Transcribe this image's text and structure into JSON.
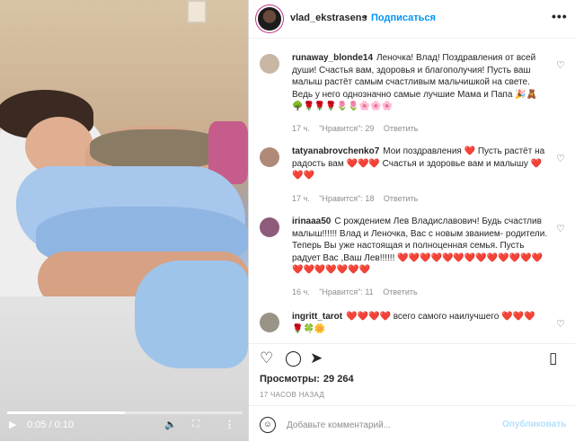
{
  "video": {
    "time_label": "0:05 / 0:10",
    "progress": 0.5
  },
  "post": {
    "author": "vlad_ekstrasens",
    "dot": "•",
    "follow_label": "Подписаться",
    "more_label": "•••"
  },
  "comments": [
    {
      "user": "runaway_blonde14",
      "text": "Леночка! Влад! Поздравления от всей души! Счастья вам, здоровья и благополучия! Пусть ваш малыш растёт самым счастливым мальчишкой на свете. Ведь у него однозначно самые лучшие Мама и Папа 🎉🧸",
      "extra": "🌳🌹🌹🌹🌷🌷🌸🌸🌸",
      "time": "17 ч.",
      "likes": "\"Нравится\": 29",
      "reply": "Ответить",
      "avatar_color": "#c9b7a6"
    },
    {
      "user": "tatyanabrovchenko7",
      "text": "Мои поздравления ❤️ Пусть растёт на радость вам ❤️❤️❤️ Счастья и здоровье вам и малышу ❤️",
      "extra": "❤️❤️",
      "time": "17 ч.",
      "likes": "\"Нравится\": 18",
      "reply": "Ответить",
      "avatar_color": "#b08a78"
    },
    {
      "user": "irinaaa50",
      "text": "С рождением Лев Владиславович! Будь счастлив малыш!!!!!! Влад и Леночка, Вас с новым званием- родители. Теперь Вы уже настоящая и полноценная семья. Пусть радует Вас ,Ваш Лев!!!!!! ❤️❤️❤️❤️❤️❤️❤️❤️❤️❤️❤️❤️❤️❤️❤️❤️❤️❤️❤️❤️",
      "extra": "",
      "time": "16 ч.",
      "likes": "\"Нравится\": 11",
      "reply": "Ответить",
      "avatar_color": "#8e5b7a"
    },
    {
      "user": "ingritt_tarot",
      "text": "❤️❤️❤️❤️ всего самого наилучшего ❤️❤️❤️",
      "extra": "🌹🍀🌼",
      "time": "",
      "likes": "",
      "reply": "",
      "avatar_color": "#9a9488"
    }
  ],
  "stats": {
    "views_label": "Просмотры:",
    "views_value": "29 264",
    "ago": "17 ЧАСОВ НАЗАД"
  },
  "composer": {
    "placeholder": "Добавьте комментарий...",
    "publish_label": "Опубликовать"
  }
}
